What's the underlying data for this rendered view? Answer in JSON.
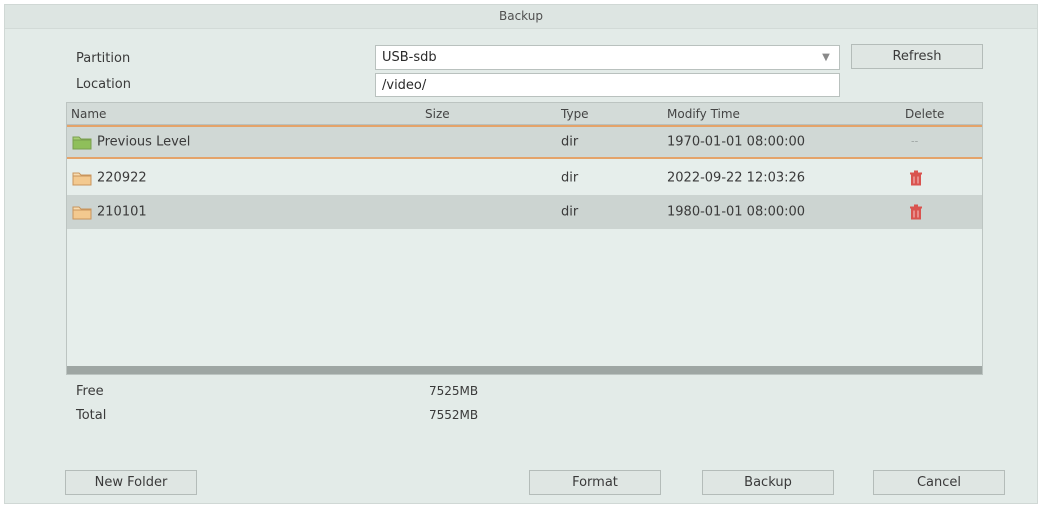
{
  "dialog": {
    "title": "Backup"
  },
  "form": {
    "partition_label": "Partition",
    "partition_value": "USB-sdb",
    "location_label": "Location",
    "location_value": "/video/",
    "refresh_label": "Refresh"
  },
  "table": {
    "headers": {
      "name": "Name",
      "size": "Size",
      "type": "Type",
      "modify": "Modify Time",
      "delete": "Delete"
    },
    "rows": [
      {
        "name": "Previous Level",
        "size": "",
        "type": "dir",
        "modify": "1970-01-01 08:00:00",
        "delete": "--",
        "icon": "folder-up-icon"
      },
      {
        "name": "220922",
        "size": "",
        "type": "dir",
        "modify": "2022-09-22 12:03:26",
        "delete": "",
        "icon": "folder-icon"
      },
      {
        "name": "210101",
        "size": "",
        "type": "dir",
        "modify": "1980-01-01 08:00:00",
        "delete": "",
        "icon": "folder-icon"
      }
    ]
  },
  "storage": {
    "free_label": "Free",
    "free_value": "7525MB",
    "total_label": "Total",
    "total_value": "7552MB"
  },
  "buttons": {
    "new_folder": "New Folder",
    "format": "Format",
    "backup": "Backup",
    "cancel": "Cancel"
  },
  "colors": {
    "selected_border": "#e4a36a",
    "trash": "#d9534f",
    "folder": "#f3c98f",
    "folder_up": "#8fbf5a"
  }
}
